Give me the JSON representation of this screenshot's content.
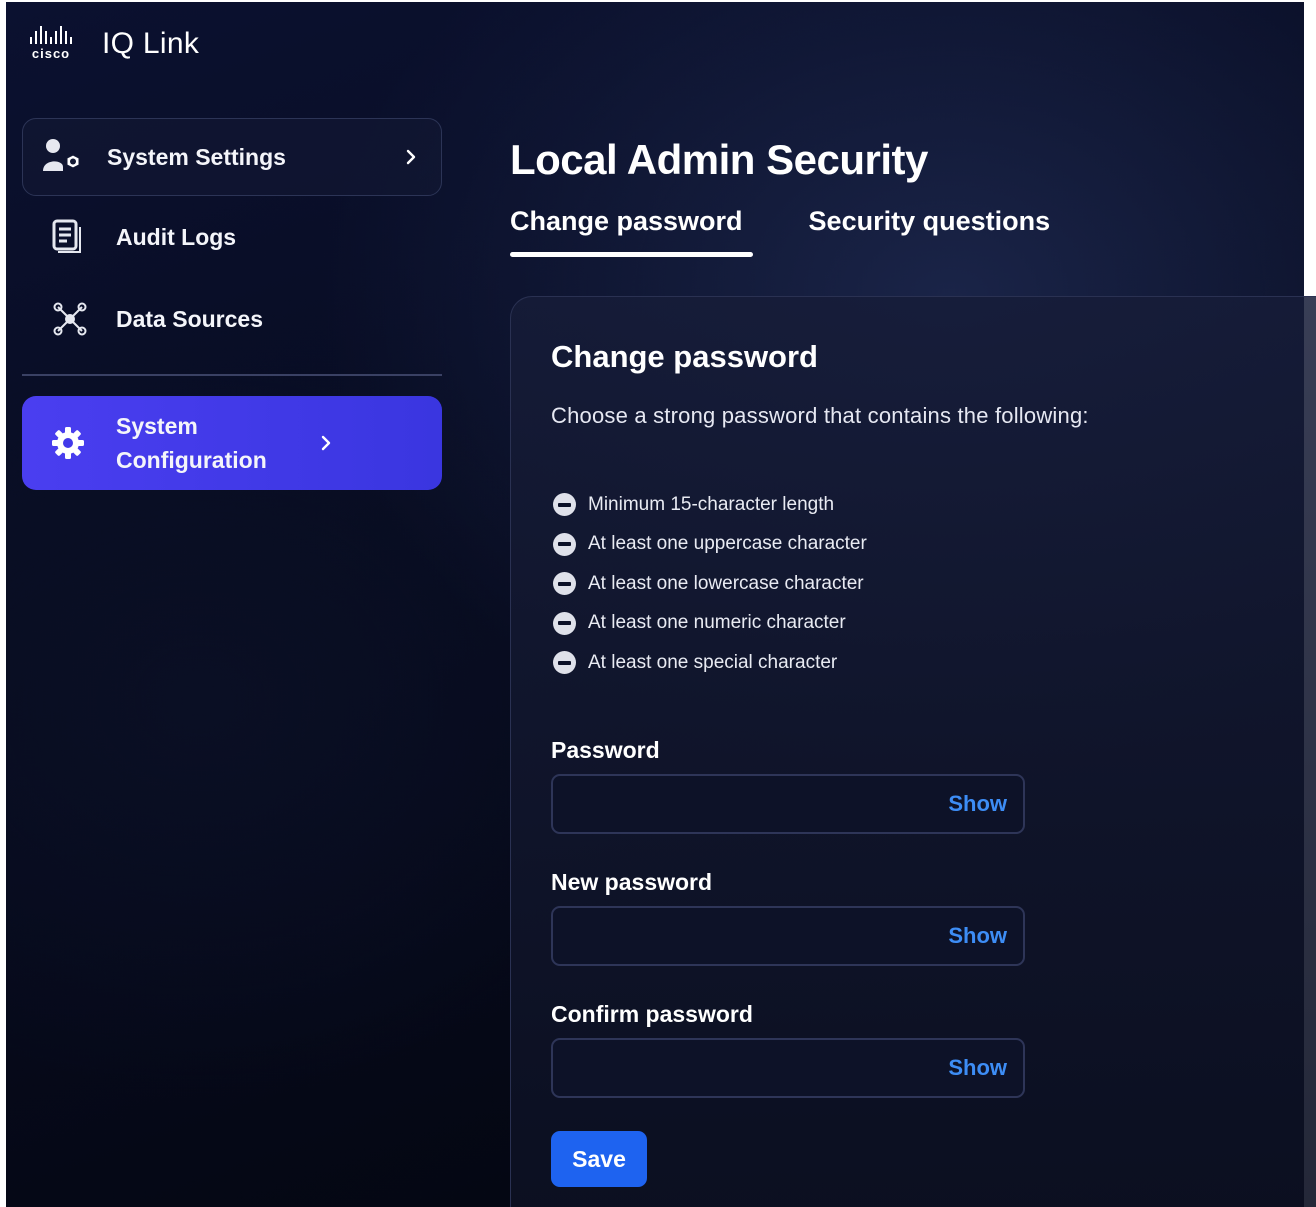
{
  "app": {
    "brand_logo": "cisco",
    "brand_word": "cisco",
    "title": "IQ Link"
  },
  "sidebar": {
    "items": [
      {
        "label": "System Settings",
        "icon": "user-gear-icon",
        "has_chevron": true,
        "style": "card"
      },
      {
        "label": "Audit Logs",
        "icon": "document-icon",
        "has_chevron": false
      },
      {
        "label": "Data Sources",
        "icon": "network-nodes-icon",
        "has_chevron": false
      },
      {
        "label": "System Configuration",
        "icon": "gear-icon",
        "has_chevron": true,
        "active": true
      }
    ]
  },
  "main": {
    "page_title": "Local Admin Security",
    "tabs": [
      {
        "label": "Change password",
        "active": true
      },
      {
        "label": "Security questions",
        "active": false
      }
    ],
    "panel": {
      "title": "Change password",
      "description": "Choose a strong password that contains the following:",
      "requirements": [
        "Minimum 15-character length",
        "At least one uppercase character",
        "At least one lowercase character",
        "At least one numeric character",
        "At least one special character"
      ],
      "fields": [
        {
          "label": "Password",
          "value": "",
          "show_label": "Show"
        },
        {
          "label": "New password",
          "value": "",
          "show_label": "Show"
        },
        {
          "label": "Confirm password",
          "value": "",
          "show_label": "Show"
        }
      ],
      "save_label": "Save"
    }
  },
  "colors": {
    "accent_active": "#4a3ef0",
    "link": "#3d8df5",
    "primary_button": "#1e63f0",
    "background": "#070b1f"
  }
}
